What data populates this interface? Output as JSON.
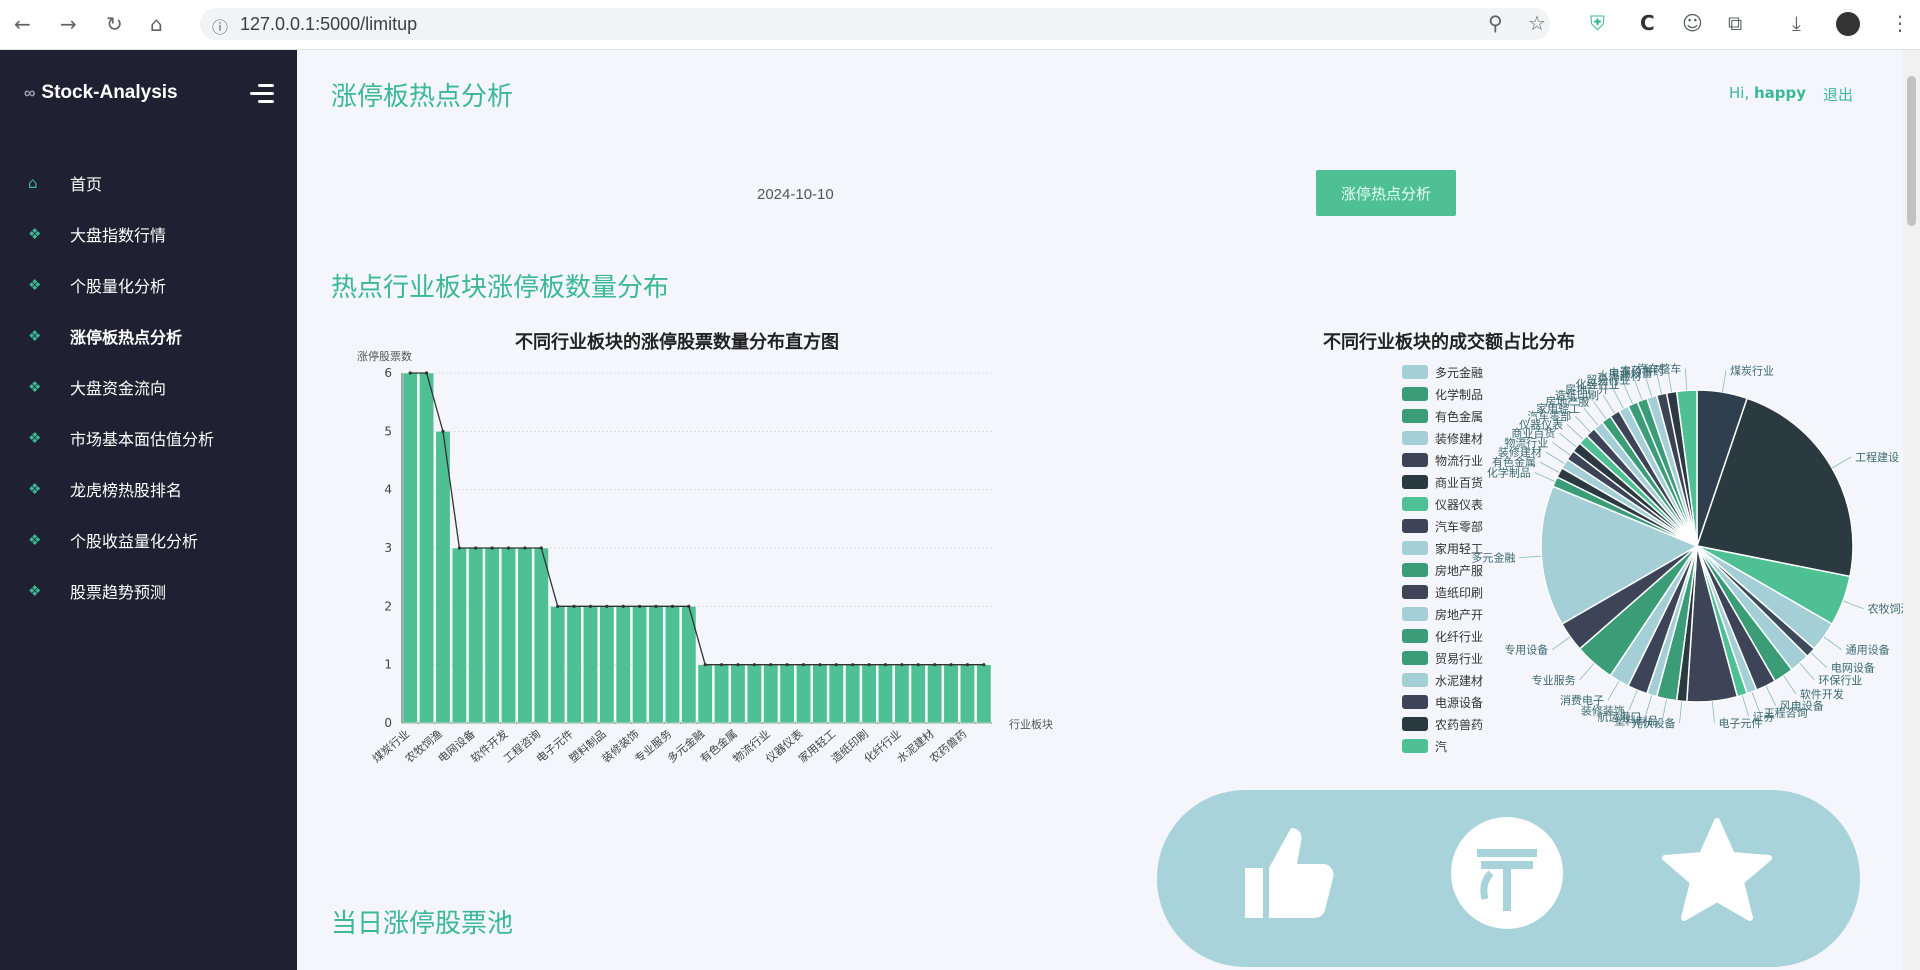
{
  "browser": {
    "url": "127.0.0.1:5000/limitup"
  },
  "sidebar": {
    "brand": "Stock-Analysis",
    "items": [
      {
        "label": "首页",
        "icon": "home-icon"
      },
      {
        "label": "大盘指数行情",
        "icon": "cube-icon"
      },
      {
        "label": "个股量化分析",
        "icon": "cube-icon"
      },
      {
        "label": "涨停板热点分析",
        "icon": "cube-icon"
      },
      {
        "label": "大盘资金流向",
        "icon": "cube-icon"
      },
      {
        "label": "市场基本面估值分析",
        "icon": "cube-icon"
      },
      {
        "label": "龙虎榜热股排名",
        "icon": "cube-icon"
      },
      {
        "label": "个股收益量化分析",
        "icon": "cube-icon"
      },
      {
        "label": "股票趋势预测",
        "icon": "cube-icon"
      }
    ]
  },
  "header": {
    "title": "涨停板热点分析",
    "greeting": "Hi, ",
    "username": "happy",
    "logout": "退出"
  },
  "form": {
    "date_value": "2024-10-10",
    "button": "涨停热点分析"
  },
  "section1": {
    "title": "热点行业板块涨停板数量分布"
  },
  "section2": {
    "title": "当日涨停股票池"
  },
  "colors": {
    "accent": "#3bb894",
    "bar": "#4fc094",
    "sidebar": "#1f2031"
  },
  "chart_data": [
    {
      "type": "bar",
      "title": "不同行业板块的涨停股票数量分布直方图",
      "ylabel": "涨停股票数",
      "xlabel": "行业板块",
      "ylim": [
        0,
        6
      ],
      "yticks": [
        "0",
        "1",
        "2",
        "3",
        "4",
        "5",
        "6"
      ],
      "x_tick_labels": [
        "煤炭行业",
        "农牧饲渔",
        "电网设备",
        "软件开发",
        "工程咨询",
        "电子元件",
        "塑料制品",
        "装修装饰",
        "专业服务",
        "多元金融",
        "有色金属",
        "物流行业",
        "仪器仪表",
        "家用轻工",
        "造纸印刷",
        "化纤行业",
        "水泥建材",
        "农药兽药"
      ],
      "values": [
        6,
        6,
        5,
        3,
        3,
        3,
        3,
        3,
        3,
        2,
        2,
        2,
        2,
        2,
        2,
        2,
        2,
        2,
        1,
        1,
        1,
        1,
        1,
        1,
        1,
        1,
        1,
        1,
        1,
        1,
        1,
        1,
        1,
        1,
        1,
        1
      ]
    },
    {
      "type": "pie",
      "title": "不同行业板块的成交额占比分布",
      "legend": [
        "多元金融",
        "化学制品",
        "有色金属",
        "装修建材",
        "物流行业",
        "商业百货",
        "仪器仪表",
        "汽车零部",
        "家用轻工",
        "房地产服",
        "造纸印刷",
        "房地产开",
        "化纤行业",
        "贸易行业",
        "水泥建材",
        "电源设备",
        "农药兽药",
        "汽"
      ],
      "slices": [
        {
          "label": "煤炭行业",
          "value": 5,
          "color": "#2f3f4d"
        },
        {
          "label": "工程建设",
          "value": 22,
          "color": "#2b3a40"
        },
        {
          "label": "农牧饲渔",
          "value": 5,
          "color": "#4fc094"
        },
        {
          "label": "通用设备",
          "value": 3,
          "color": "#a5cfd6"
        },
        {
          "label": "电网设备",
          "value": 1,
          "color": "#3d4a5c"
        },
        {
          "label": "环保行业",
          "value": 2,
          "color": "#a5cfd6"
        },
        {
          "label": "软件开发",
          "value": 2,
          "color": "#3b9c78"
        },
        {
          "label": "风电设备",
          "value": 2,
          "color": "#3d4458"
        },
        {
          "label": "工程咨询",
          "value": 1,
          "color": "#a5cfd6"
        },
        {
          "label": "证券",
          "value": 1,
          "color": "#4fc094"
        },
        {
          "label": "电子元件",
          "value": 5,
          "color": "#3d4458"
        },
        {
          "label": "光伏设备",
          "value": 1,
          "color": "#2b3a40"
        },
        {
          "label": "塑料制品",
          "value": 2,
          "color": "#3b9c78"
        },
        {
          "label": "航运港口",
          "value": 1,
          "color": "#a5cfd6"
        },
        {
          "label": "装修装饰",
          "value": 2,
          "color": "#3d4458"
        },
        {
          "label": "消费电子",
          "value": 2,
          "color": "#a5cfd6"
        },
        {
          "label": "专业服务",
          "value": 4,
          "color": "#3b9c78"
        },
        {
          "label": "专用设备",
          "value": 3,
          "color": "#3d4458"
        },
        {
          "label": "多元金融",
          "value": 14,
          "color": "#a5cfd6"
        },
        {
          "label": "化学制品",
          "value": 1,
          "color": "#3b9c78"
        },
        {
          "label": "有色金属",
          "value": 1,
          "color": "#2b3a40"
        },
        {
          "label": "装修建材",
          "value": 1,
          "color": "#a5cfd6"
        },
        {
          "label": "物流行业",
          "value": 1,
          "color": "#3d4458"
        },
        {
          "label": "商业百货",
          "value": 1,
          "color": "#2b3a40"
        },
        {
          "label": "仪器仪表",
          "value": 1,
          "color": "#4fc094"
        },
        {
          "label": "汽车零部",
          "value": 1,
          "color": "#3d4458"
        },
        {
          "label": "家用轻工",
          "value": 1,
          "color": "#a5cfd6"
        },
        {
          "label": "房地产服",
          "value": 1,
          "color": "#3b9c78"
        },
        {
          "label": "造纸印刷",
          "value": 1,
          "color": "#3d4458"
        },
        {
          "label": "房地产开",
          "value": 1,
          "color": "#a5cfd6"
        },
        {
          "label": "化纤行业",
          "value": 1,
          "color": "#3b9c78"
        },
        {
          "label": "贸易行业",
          "value": 1,
          "color": "#3b9c78"
        },
        {
          "label": "水泥建材",
          "value": 1,
          "color": "#a5cfd6"
        },
        {
          "label": "电源设备",
          "value": 1,
          "color": "#3d4458"
        },
        {
          "label": "农药兽药",
          "value": 1,
          "color": "#2b3a40"
        },
        {
          "label": "汽车整车",
          "value": 2,
          "color": "#4fc094"
        }
      ]
    }
  ]
}
